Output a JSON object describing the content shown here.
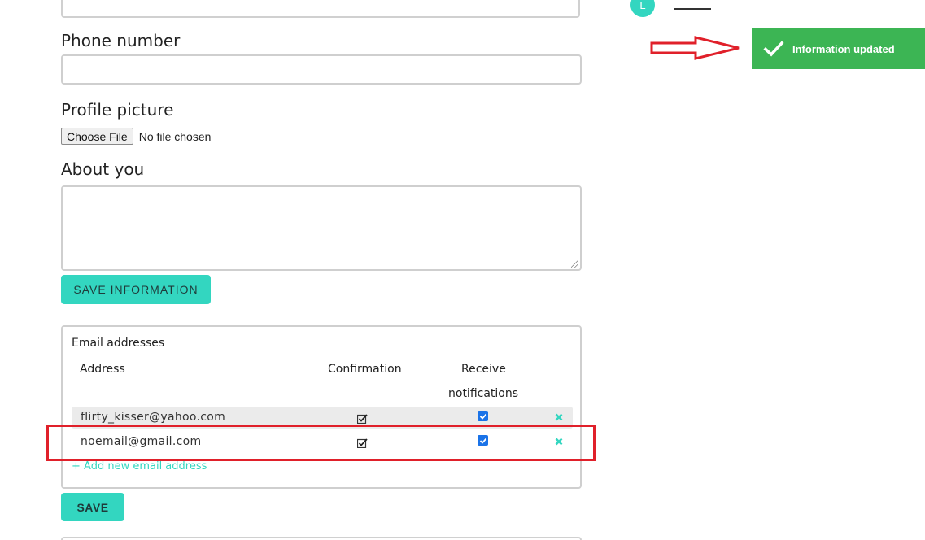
{
  "form": {
    "phone_label": "Phone number",
    "phone_value": "",
    "profile_picture_label": "Profile picture",
    "choose_file_label": "Choose File",
    "no_file_text": "No file chosen",
    "about_label": "About you",
    "about_value": "",
    "save_information_label": "SAVE INFORMATION"
  },
  "emails": {
    "title": "Email addresses",
    "headers": {
      "address": "Address",
      "confirmation": "Confirmation",
      "receive_line1": "Receive",
      "receive_line2": "notifications"
    },
    "rows": [
      {
        "address": "flirty_kisser@yahoo.com",
        "confirmed": true,
        "receive_notifications": true
      },
      {
        "address": "noemail@gmail.com",
        "confirmed": true,
        "receive_notifications": true
      }
    ],
    "add_link": "+ Add new email address",
    "save_label": "SAVE"
  },
  "header": {
    "avatar_initial": "L"
  },
  "toast": {
    "message": "Information updated",
    "color": "#3cb554"
  },
  "annotation": {
    "highlight_color": "#e0202a",
    "arrow_color": "#e0202a"
  },
  "colors": {
    "accent": "#33d6c0"
  }
}
